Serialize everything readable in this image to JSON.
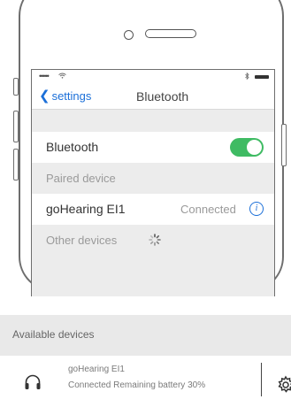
{
  "status_bar": {
    "signal": "•••••",
    "wifi_icon": "wifi-icon",
    "bt_icon": "bluetooth-icon"
  },
  "nav": {
    "back_label": "settings",
    "title": "Bluetooth"
  },
  "bluetooth_row": {
    "label": "Bluetooth",
    "enabled": true,
    "toggle_color": "#3fbb63"
  },
  "paired": {
    "section_label": "Paired device",
    "devices": [
      {
        "name": "goHearing EI1",
        "status": "Connected",
        "info_icon": "i"
      }
    ]
  },
  "other": {
    "section_label": "Other devices",
    "spinner": "loading-spinner-icon"
  },
  "available": {
    "header": "Available devices",
    "devices": [
      {
        "name": "goHearing EI1",
        "status": "Connected Remaining battery 30%",
        "icon": "headphones-icon"
      }
    ]
  },
  "accent_color": "#1b6fd8"
}
